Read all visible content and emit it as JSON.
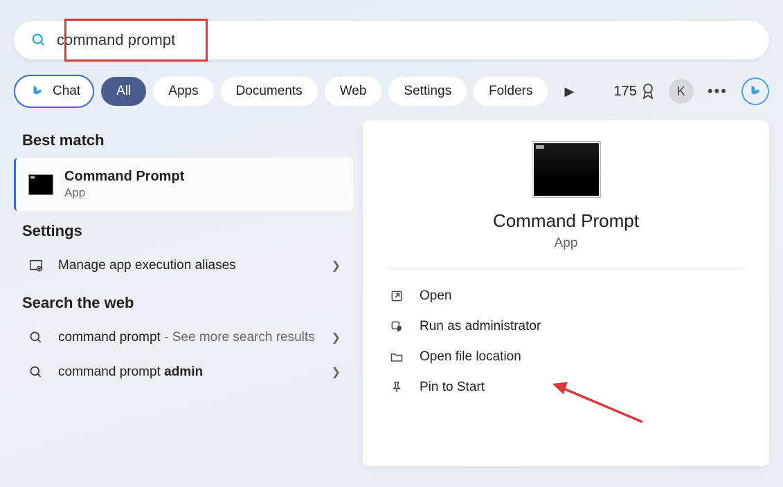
{
  "search": {
    "query": "command prompt"
  },
  "tabs": {
    "chat": "Chat",
    "filters": [
      "All",
      "Apps",
      "Documents",
      "Web",
      "Settings",
      "Folders"
    ],
    "active_filter_index": 0
  },
  "header_right": {
    "points": "175",
    "avatar_letter": "K"
  },
  "left": {
    "best_match_heading": "Best match",
    "best_match": {
      "title": "Command Prompt",
      "subtitle": "App"
    },
    "settings_heading": "Settings",
    "settings_items": [
      {
        "text": "Manage app execution aliases"
      }
    ],
    "web_heading": "Search the web",
    "web_items": [
      {
        "prefix": "command prompt",
        "suffix": " - See more search results"
      },
      {
        "prefix": "command prompt ",
        "bold": "admin",
        "suffix": ""
      }
    ]
  },
  "right": {
    "title": "Command Prompt",
    "subtitle": "App",
    "actions": [
      "Open",
      "Run as administrator",
      "Open file location",
      "Pin to Start"
    ]
  }
}
